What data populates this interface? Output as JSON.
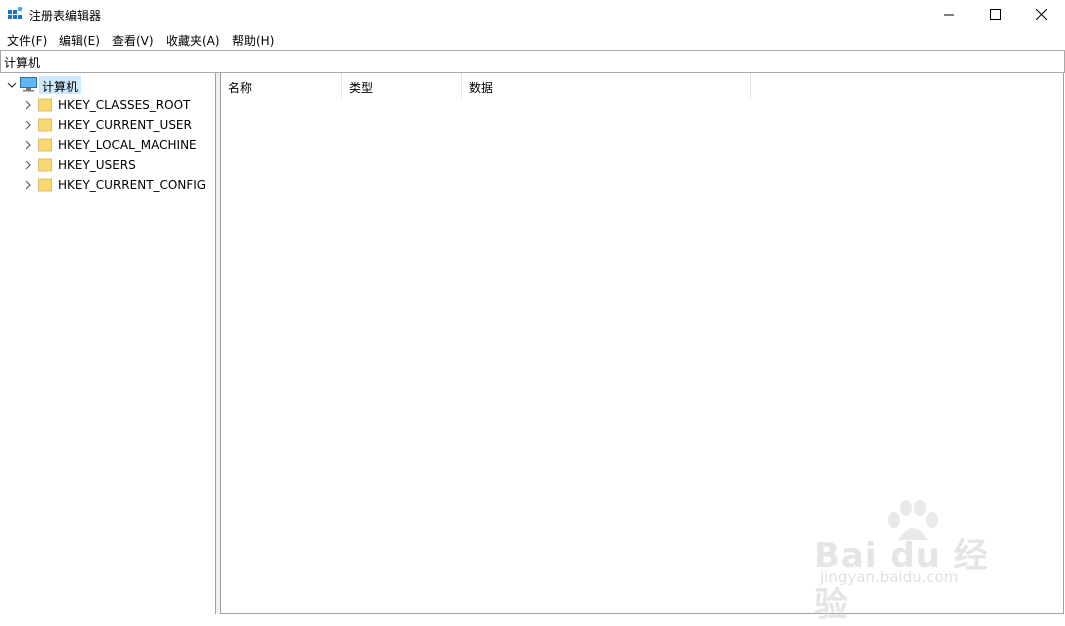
{
  "window": {
    "title": "注册表编辑器",
    "minimize_icon": "minimize-icon",
    "maximize_icon": "maximize-icon",
    "close_icon": "close-icon"
  },
  "menu": {
    "file": "文件(F)",
    "edit": "编辑(E)",
    "view": "查看(V)",
    "favorites": "收藏夹(A)",
    "help": "帮助(H)"
  },
  "address": {
    "value": "计算机"
  },
  "tree": {
    "root": "计算机",
    "items": [
      {
        "label": "HKEY_CLASSES_ROOT"
      },
      {
        "label": "HKEY_CURRENT_USER"
      },
      {
        "label": "HKEY_LOCAL_MACHINE"
      },
      {
        "label": "HKEY_USERS"
      },
      {
        "label": "HKEY_CURRENT_CONFIG"
      }
    ]
  },
  "list": {
    "columns": [
      "名称",
      "类型",
      "数据"
    ]
  },
  "watermark": {
    "line1": "Bai du 经验",
    "line2": "jingyan.baidu.com"
  },
  "colors": {
    "selection": "#cde8ff",
    "folder": "#f8d775",
    "border": "#a0a0a0"
  }
}
